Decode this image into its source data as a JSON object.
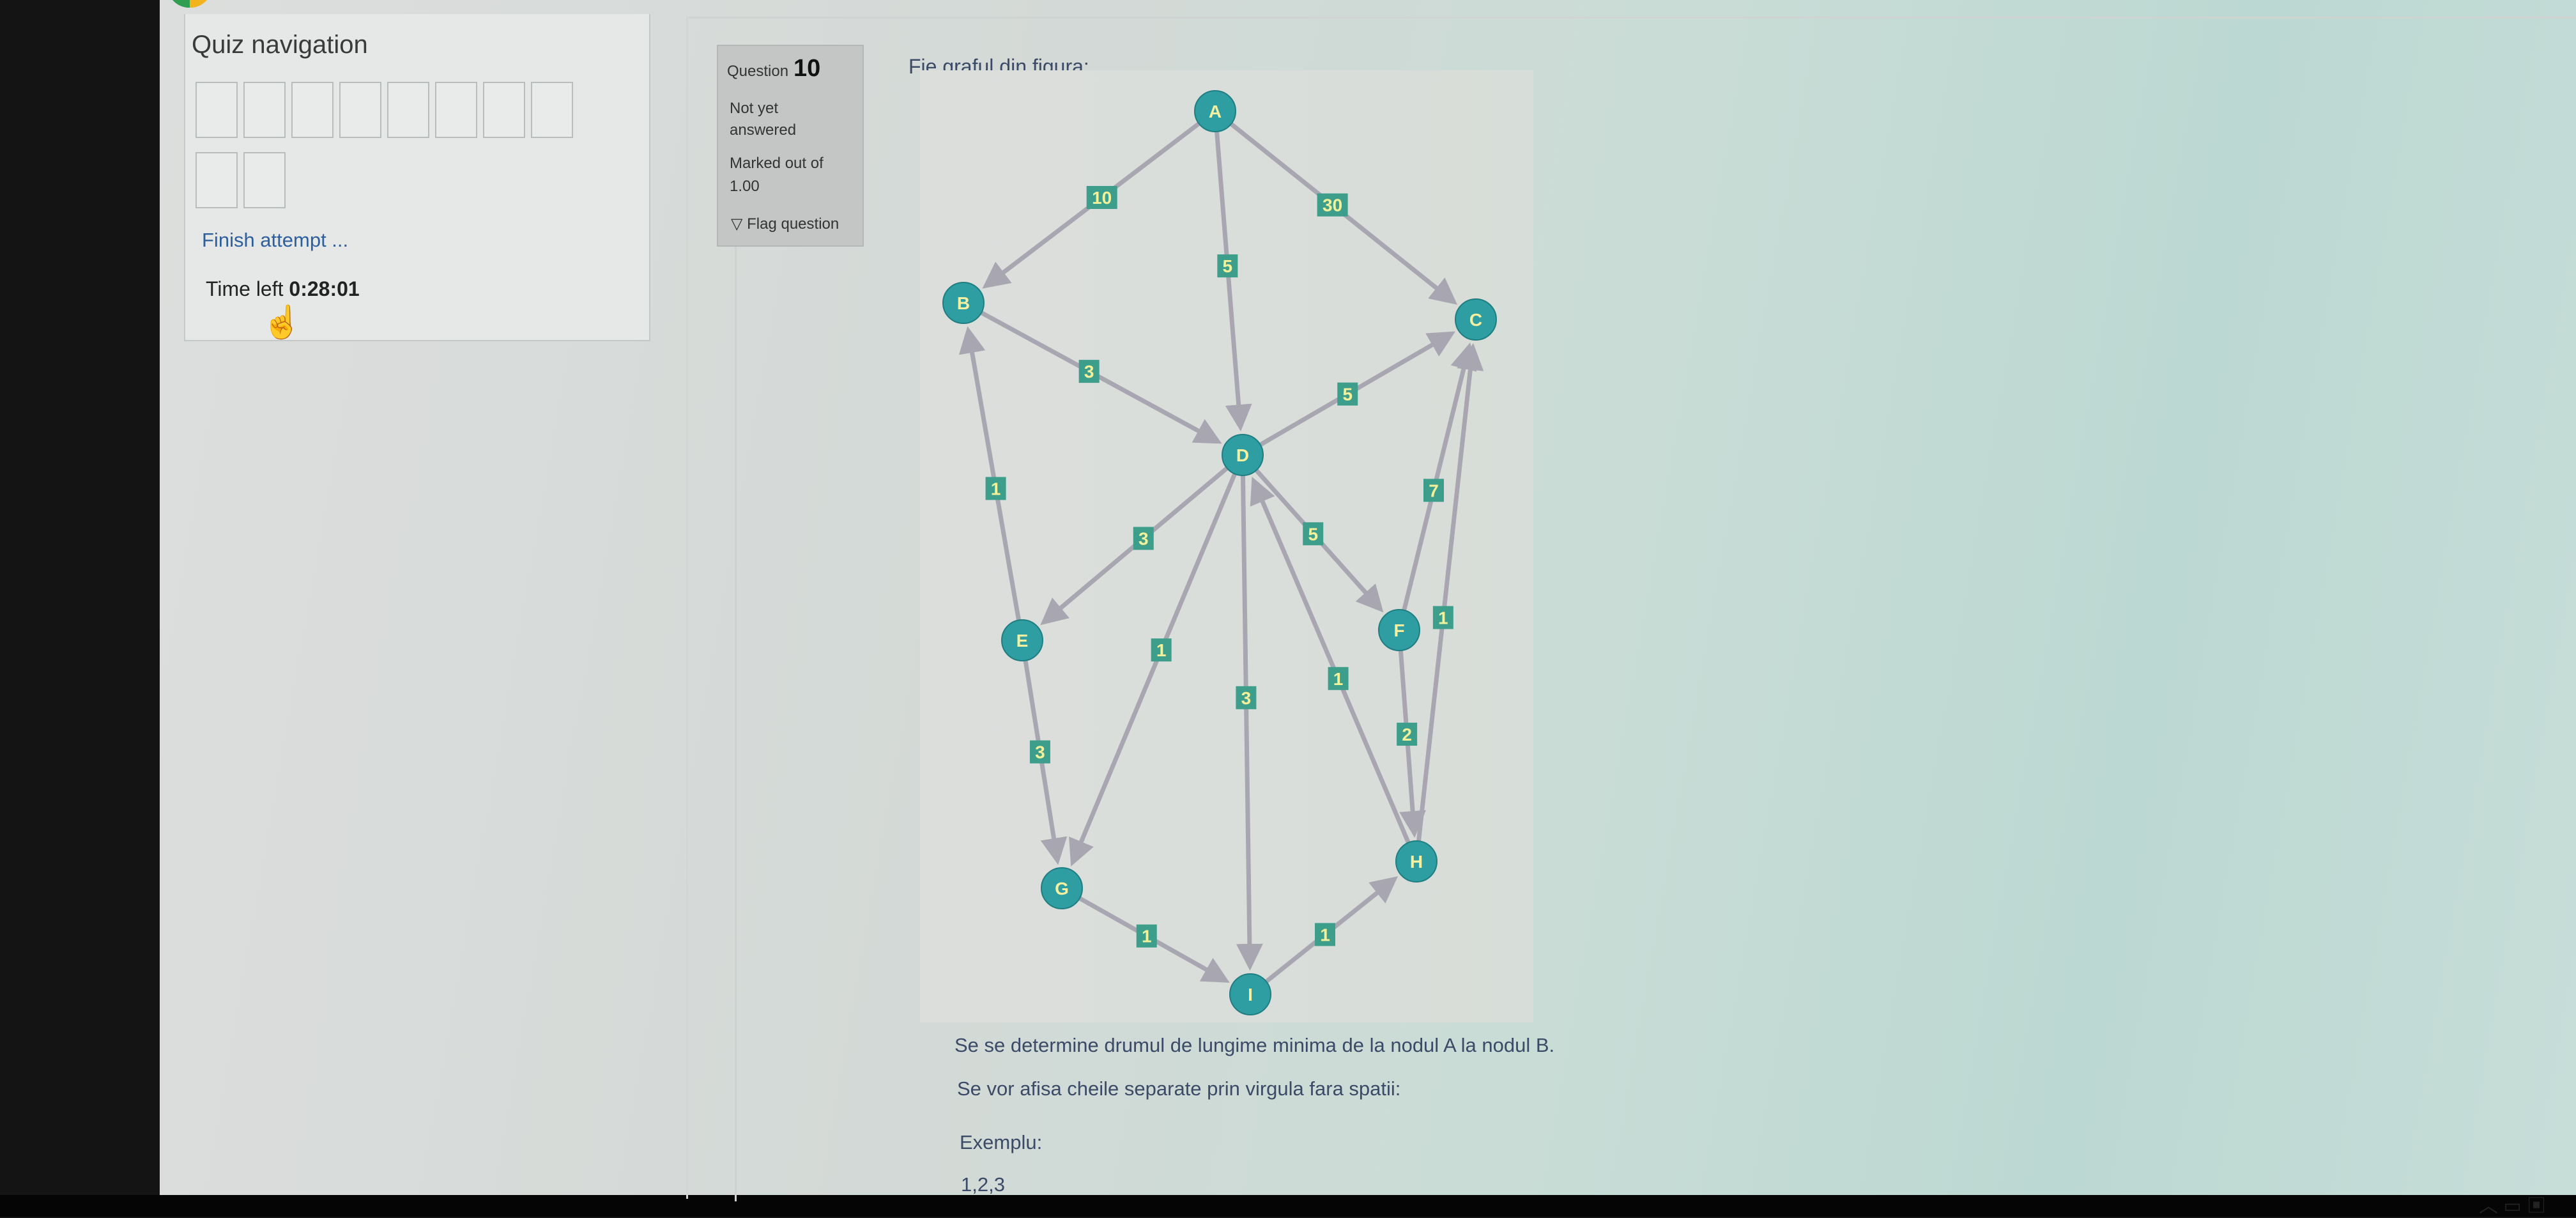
{
  "quiz_nav": {
    "title": "Quiz navigation",
    "box_count": 10,
    "finish_label": "Finish attempt ...",
    "time_label": "Time left ",
    "time_value": "0:28:01"
  },
  "question": {
    "label": "Question",
    "number": "10",
    "status_line1": "Not yet",
    "status_line2": "answered",
    "marked_line1": "Marked out of",
    "marked_line2": "1.00",
    "flag_label": "Flag question",
    "text": "Fie graful din figura:",
    "para1": "Se se determine drumul de lungime minima de la nodul A la nodul B.",
    "para2": "Se vor afisa cheile separate prin virgula fara spatii:",
    "para3": "Exemplu:",
    "para4": "1,2,3"
  },
  "graph": {
    "nodes": [
      "A",
      "B",
      "C",
      "D",
      "E",
      "F",
      "G",
      "H",
      "I"
    ],
    "edges": [
      {
        "from": "A",
        "to": "B",
        "weight": "10"
      },
      {
        "from": "A",
        "to": "D",
        "weight": "5"
      },
      {
        "from": "A",
        "to": "C",
        "weight": "30"
      },
      {
        "from": "B",
        "to": "D",
        "weight": "3"
      },
      {
        "from": "D",
        "to": "C",
        "weight": "5"
      },
      {
        "from": "E",
        "to": "B",
        "weight": "1"
      },
      {
        "from": "D",
        "to": "E",
        "weight": "3"
      },
      {
        "from": "D",
        "to": "F",
        "weight": "5"
      },
      {
        "from": "F",
        "to": "C",
        "weight": "7"
      },
      {
        "from": "H",
        "to": "C",
        "weight": "1"
      },
      {
        "from": "D",
        "to": "G",
        "weight": "1"
      },
      {
        "from": "H",
        "to": "D",
        "weight": "1"
      },
      {
        "from": "D",
        "to": "I",
        "weight": "3"
      },
      {
        "from": "F",
        "to": "H",
        "weight": "2"
      },
      {
        "from": "E",
        "to": "G",
        "weight": "3"
      },
      {
        "from": "G",
        "to": "I",
        "weight": "1"
      },
      {
        "from": "I",
        "to": "H",
        "weight": "1"
      }
    ]
  },
  "colors": {
    "node_fill": "#2e9ea2",
    "node_text": "#f5f0a0",
    "edge": "#a8a6b0",
    "weight_bg": "#3e9e8c",
    "link": "#2d5f9e"
  }
}
